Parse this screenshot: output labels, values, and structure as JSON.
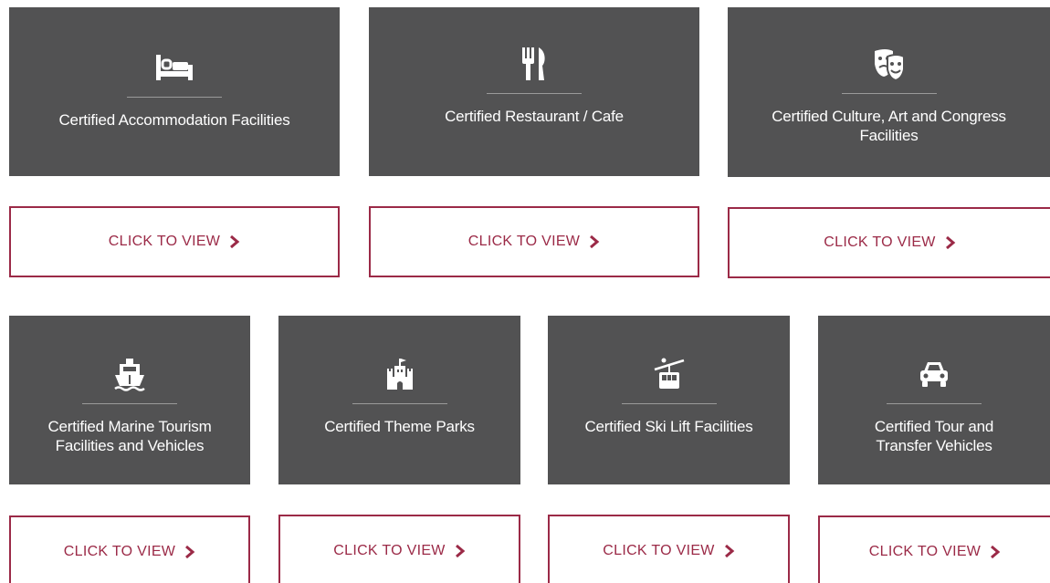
{
  "colors": {
    "card_bg": "#525253",
    "accent": "#9b2a47",
    "text_light": "#ffffff"
  },
  "cards": [
    {
      "title": "Certified Accommodation Facilities",
      "icon": "bed-icon",
      "button_label": "CLICK TO VIEW"
    },
    {
      "title": "Certified Restaurant / Cafe",
      "icon": "fork-knife-icon",
      "button_label": "CLICK TO VIEW"
    },
    {
      "title": "Certified Culture, Art and Congress Facilities",
      "icon": "theater-masks-icon",
      "button_label": "CLICK TO VIEW"
    },
    {
      "title": "Certified Marine Tourism Facilities and Vehicles",
      "icon": "ship-icon",
      "button_label": "CLICK TO VIEW"
    },
    {
      "title": "Certified Theme Parks",
      "icon": "castle-icon",
      "button_label": "CLICK TO VIEW"
    },
    {
      "title": "Certified Ski Lift Facilities",
      "icon": "cable-car-icon",
      "button_label": "CLICK TO VIEW"
    },
    {
      "title": "Certified Tour and Transfer Vehicles",
      "icon": "car-icon",
      "button_label": "CLICK TO VIEW"
    }
  ]
}
